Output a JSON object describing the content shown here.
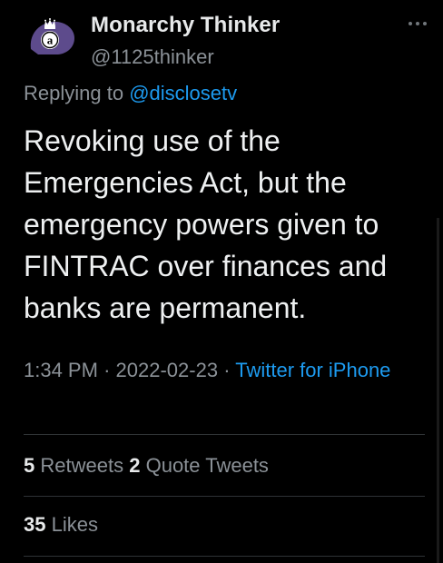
{
  "tweet": {
    "author": {
      "display_name": "Monarchy Thinker",
      "handle": "@1125thinker",
      "avatar_icon": "crown-monogram-avatar",
      "avatar_bg": "#5d4b8c"
    },
    "more_icon": "more-horizontal-icon",
    "reply": {
      "prefix": "Replying to",
      "mention": "@disclosetv"
    },
    "text": "Revoking use of the Emergencies Act, but the emergency powers given to FINTRAC over finances and banks are permanent.",
    "meta": {
      "time": "1:34 PM",
      "separator": "·",
      "date": "2022-02-23",
      "source": "Twitter for iPhone"
    },
    "stats": {
      "retweets_count": "5",
      "retweets_label": "Retweets",
      "quotes_count": "2",
      "quotes_label": "Quote Tweets",
      "likes_count": "35",
      "likes_label": "Likes"
    }
  },
  "colors": {
    "background": "#000000",
    "text_primary": "#e7e9ea",
    "text_secondary": "#8b9197",
    "link": "#1d9bf0",
    "divider": "#2f3336"
  }
}
